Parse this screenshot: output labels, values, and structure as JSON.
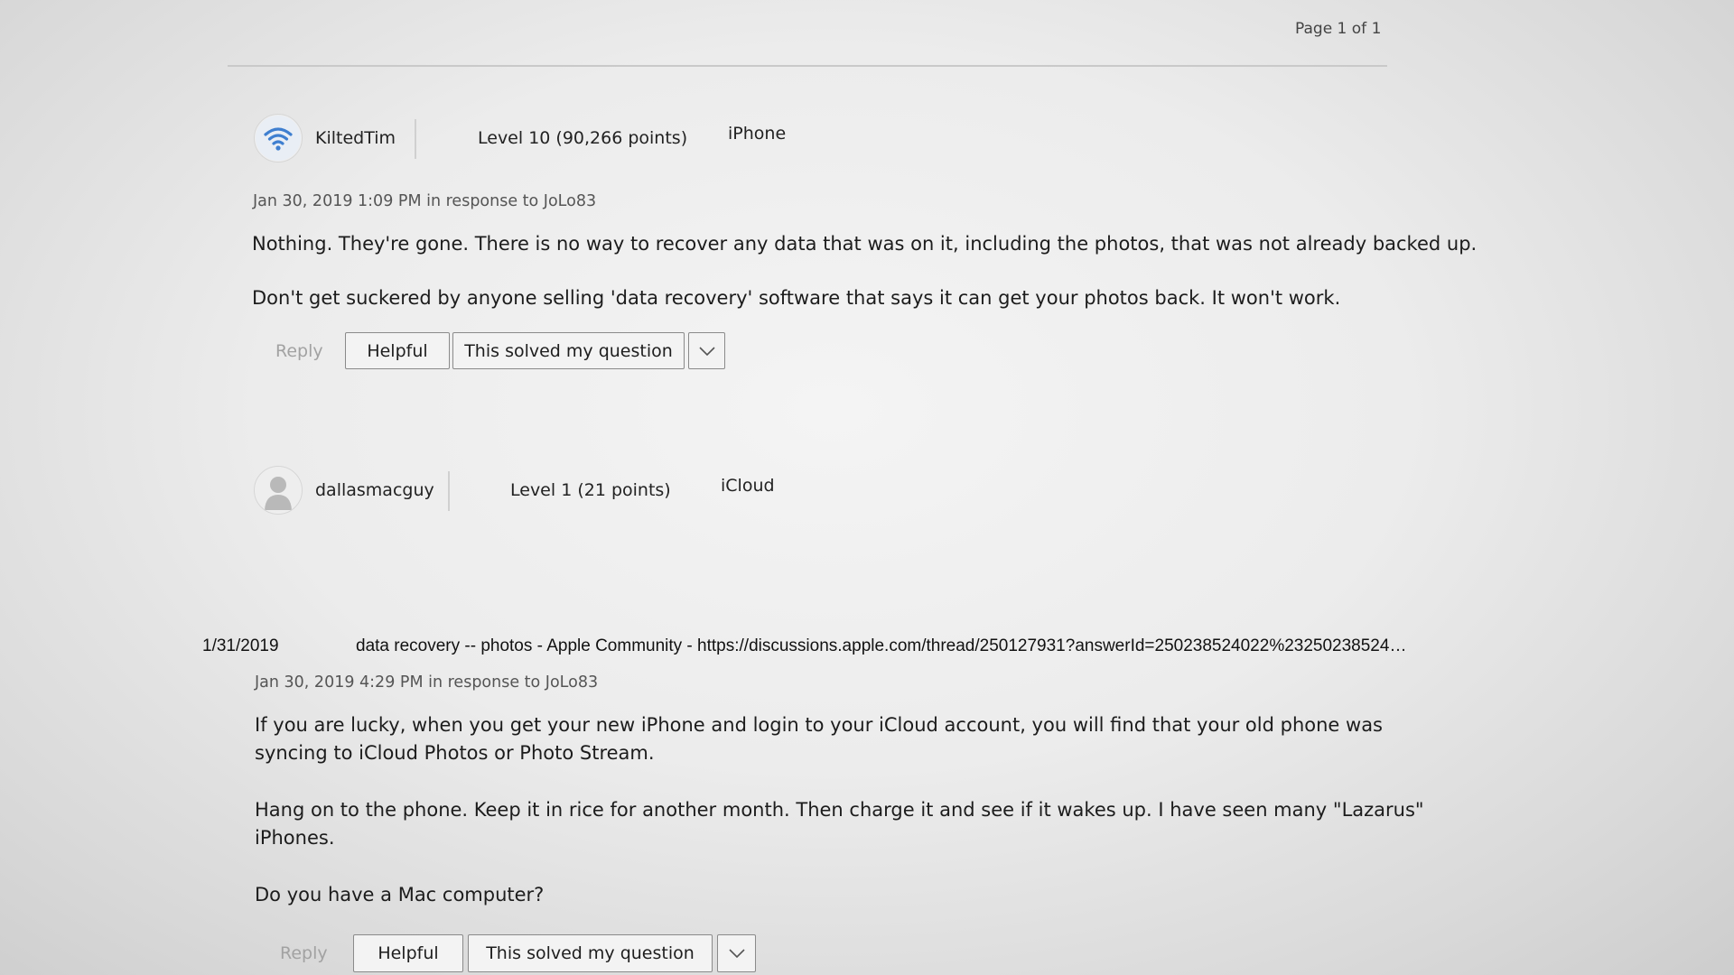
{
  "pagination": {
    "label": "Page 1 of 1"
  },
  "print_header": {
    "date": "1/31/2019",
    "title": "data recovery -- photos - Apple Community - https://discussions.apple.com/thread/250127931?answerId=250238524022%23250238524…"
  },
  "posts": [
    {
      "author": "KiltedTim",
      "avatar_icon": "wifi-icon",
      "level": "Level 10  (90,266 points)",
      "community": "iPhone",
      "meta": "Jan 30, 2019 1:09 PM in response to JoLo83",
      "paragraphs": [
        "Nothing. They're gone. There is no way to recover any data that was on it, including the photos, that was not already backed up.",
        "Don't get suckered by anyone selling 'data recovery' software that says it can get your photos back. It won't work."
      ],
      "actions": {
        "reply": "Reply",
        "helpful": "Helpful",
        "solved": "This solved my question"
      }
    },
    {
      "author": "dallasmacguy",
      "avatar_icon": "person-silhouette-icon",
      "level": "Level 1  (21 points)",
      "community": "iCloud",
      "meta": "Jan 30, 2019 4:29 PM in response to JoLo83",
      "paragraphs": [
        "If you are lucky, when you get your new iPhone and login to your iCloud account, you will find that your old phone was",
        "syncing to iCloud Photos or Photo Stream.",
        "Hang on to the phone. Keep it in rice for another month. Then charge it and see if it wakes up. I have seen many \"Lazarus\"",
        "iPhones.",
        "Do you have a Mac computer?"
      ],
      "actions": {
        "reply": "Reply",
        "helpful": "Helpful",
        "solved": "This solved my question"
      }
    }
  ],
  "colors": {
    "background": "#ececec",
    "button_border": "#8a8a8a",
    "muted_text": "#a2a2a2",
    "wifi_blue": "#3f7fd0"
  }
}
